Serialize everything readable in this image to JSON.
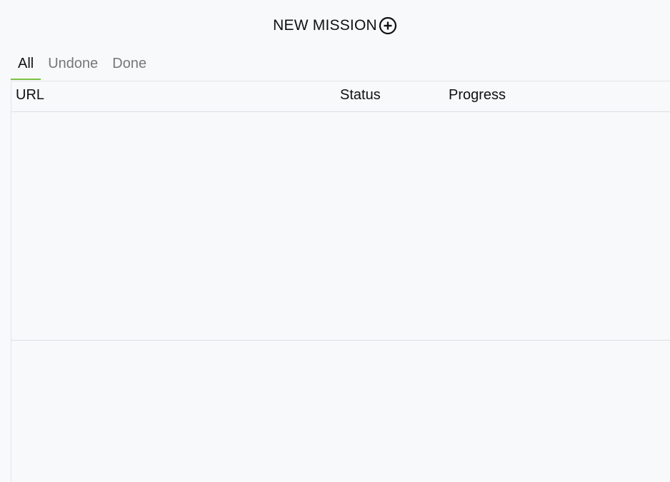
{
  "header": {
    "new_mission_label": "NEW MISSION",
    "icon": "plus-circle-icon"
  },
  "tabs": [
    {
      "label": "All",
      "active": true
    },
    {
      "label": "Undone",
      "active": false
    },
    {
      "label": "Done",
      "active": false
    }
  ],
  "table": {
    "columns": [
      "URL",
      "Status",
      "Progress"
    ],
    "rows": []
  },
  "colors": {
    "background": "#f8f9fb",
    "accent": "#7cc242",
    "border": "#dcdee2",
    "inactive_tab": "#777777"
  }
}
